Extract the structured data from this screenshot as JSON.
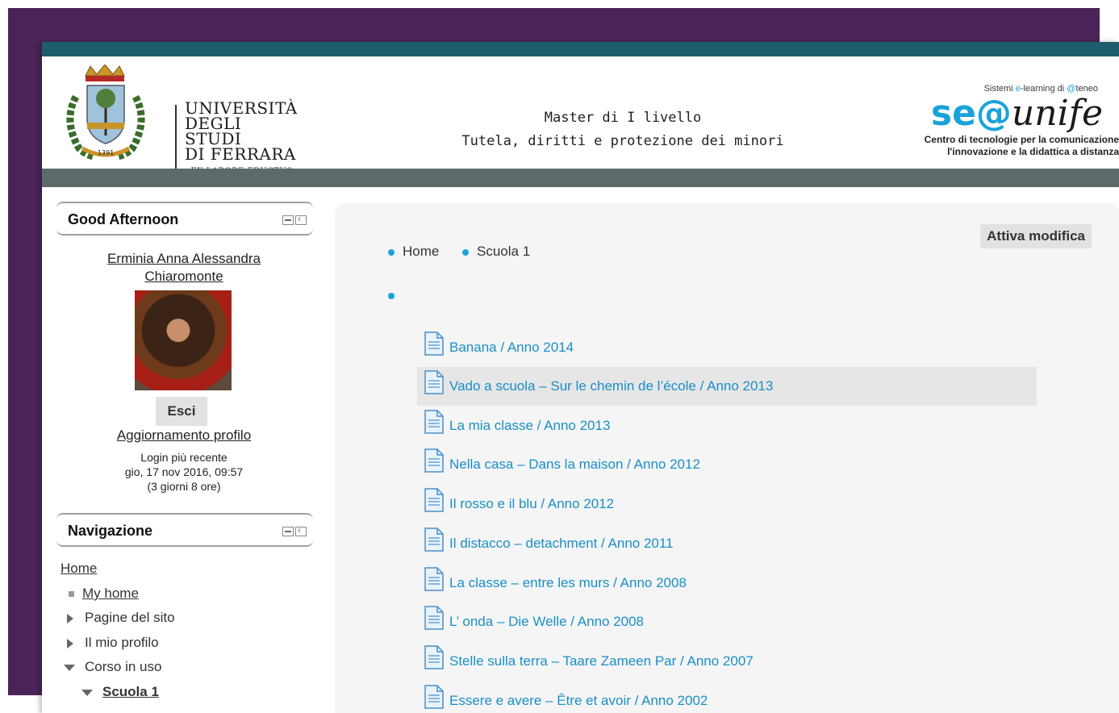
{
  "header": {
    "university_lines": [
      "UNIVERSITÀ",
      "DEGLI STUDI",
      "DI FERRARA"
    ],
    "university_motto": "- EX LABORE FRUCTUS -",
    "crest_year": "1391",
    "master_line1": "Master di I livello",
    "master_line2": "Tutela, diritti e protezione dei minori",
    "sea_small_pre": "Sistemi ",
    "sea_small_e": "e",
    "sea_small_mid": "-learning di ",
    "sea_small_at": "@",
    "sea_small_post": "teneo",
    "sea_logo_left": "se@",
    "sea_logo_right": "unife",
    "sea_caption_1": "Centro di tecnologie per la comunicazione",
    "sea_caption_2": "l'innovazione e la didattica a distanza"
  },
  "user_block": {
    "title": "Good Afternoon",
    "name_line1": "Erminia Anna Alessandra",
    "name_line2": "Chiaromonte",
    "logout_label": "Esci",
    "profile_link": "Aggiornamento profilo",
    "last_login_label": "Login più recente",
    "last_login_date": "gio, 17 nov 2016, 09:57",
    "last_login_ago": "(3 giorni 8 ore)"
  },
  "nav_block": {
    "title": "Navigazione",
    "home": "Home",
    "my_home": "My home",
    "site_pages": "Pagine del sito",
    "my_profile": "Il mio profilo",
    "current_course": "Corso in uso",
    "course_name": "Scuola 1"
  },
  "main": {
    "edit_button": "Attiva modifica",
    "breadcrumb": [
      "Home",
      "Scuola 1"
    ],
    "resources": [
      "Banana / Anno 2014",
      "Vado a scuola – Sur le chemin de l’école / Anno 2013",
      "La mia classe / Anno 2013",
      "Nella casa – Dans la maison / Anno 2012",
      "Il rosso e il blu / Anno 2012",
      "Il distacco – detachment / Anno 2011",
      "La classe – entre les murs / Anno 2008",
      "L’ onda – Die Welle / Anno 2008",
      "Stelle sulla terra – Taare Zameen Par / Anno 2007",
      "Essere e avere – Être et avoir / Anno 2002"
    ]
  },
  "colors": {
    "outer_frame": "#4a2458",
    "top_bar": "#1d5c6b",
    "sub_bar": "#5c6a6b",
    "link": "#1a8fc7",
    "accent": "#1aa3d9"
  },
  "icons": [
    "file-icon",
    "tri-right-icon",
    "tri-down-icon",
    "bullet-square-icon",
    "block-control-icon",
    "university-crest-icon"
  ]
}
